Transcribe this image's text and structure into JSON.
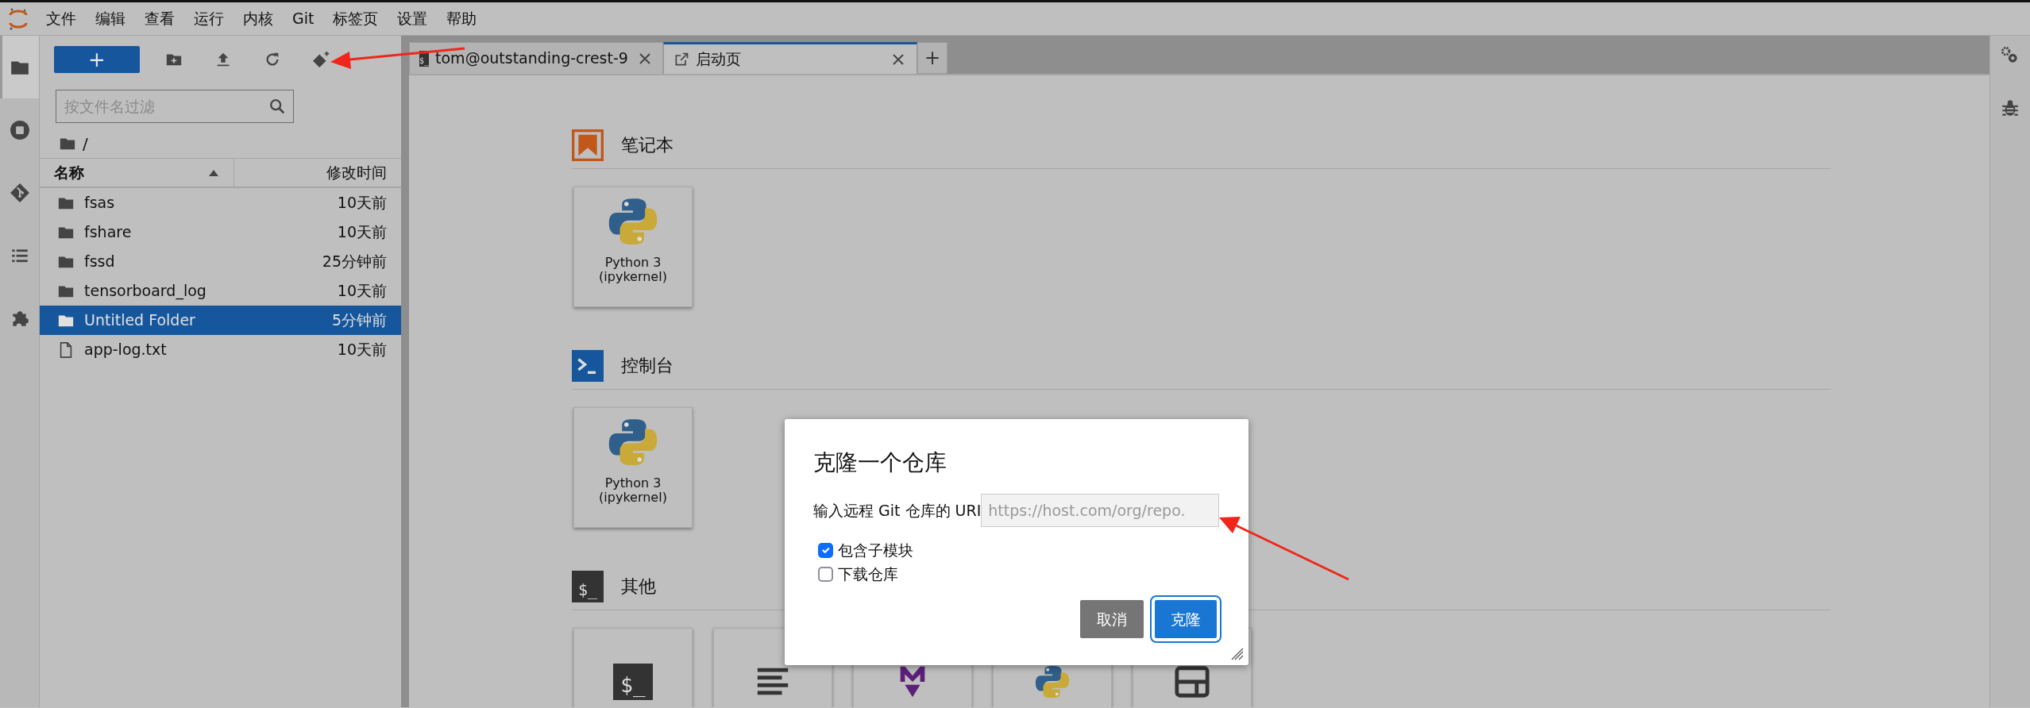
{
  "menu": [
    "文件",
    "编辑",
    "查看",
    "运行",
    "内核",
    "Git",
    "标签页",
    "设置",
    "帮助"
  ],
  "left_sidebar": [
    {
      "kind": "folder",
      "selected": true
    },
    {
      "kind": "stop",
      "selected": false
    },
    {
      "kind": "git",
      "selected": false
    },
    {
      "kind": "list",
      "selected": false
    },
    {
      "kind": "puzzle",
      "selected": false
    }
  ],
  "file_browser": {
    "new_button": "+",
    "filter": {
      "placeholder": "按文件名过滤"
    },
    "path": "/",
    "columns": [
      "名称",
      "修改时间"
    ],
    "rows": [
      {
        "kind": "folder",
        "name": "fsas",
        "modified": "10天前",
        "selected": false
      },
      {
        "kind": "folder",
        "name": "fshare",
        "modified": "10天前",
        "selected": false
      },
      {
        "kind": "folder",
        "name": "fssd",
        "modified": "25分钟前",
        "selected": false
      },
      {
        "kind": "folder",
        "name": "tensorboard_log",
        "modified": "10天前",
        "selected": false
      },
      {
        "kind": "folder",
        "name": "Untitled Folder",
        "modified": "5分钟前",
        "selected": true
      },
      {
        "kind": "file",
        "name": "app-log.txt",
        "modified": "10天前",
        "selected": false
      }
    ]
  },
  "tabs": [
    {
      "kind": "terminal",
      "icon_text": "$_",
      "label": "tom@outstanding-crest-9",
      "selected": false
    },
    {
      "kind": "launcher",
      "label": "启动页",
      "selected": true
    }
  ],
  "add_tab": "+",
  "launcher": [
    {
      "kind": "notebook",
      "title": "笔记本",
      "cards": [
        {
          "kind": "python",
          "label": "Python 3\n(ipykernel)"
        }
      ]
    },
    {
      "kind": "console",
      "title": "控制台",
      "cards": [
        {
          "kind": "python",
          "label": "Python 3\n(ipykernel)"
        }
      ]
    },
    {
      "kind": "other",
      "icon_text": "$_",
      "title": "其他",
      "cards": [
        {
          "kind": "terminal",
          "icon_text": "$_"
        },
        {
          "kind": "text"
        },
        {
          "kind": "markdown"
        },
        {
          "kind": "python"
        },
        {
          "kind": "layout"
        }
      ]
    }
  ],
  "right_sidebar": [
    {
      "kind": "gears"
    },
    {
      "kind": "bug"
    }
  ],
  "dialog": {
    "title": "克隆一个仓库",
    "uri_label": "输入远程 Git 仓库的 URI",
    "uri_field": {
      "placeholder": "https://host.com/org/repo."
    },
    "options": [
      {
        "label": "包含子模块",
        "checked": true
      },
      {
        "label": "下载仓库",
        "checked": false
      }
    ],
    "buttons": [
      {
        "kind": "cancel",
        "label": "取消"
      },
      {
        "kind": "accept",
        "label": "克隆"
      }
    ]
  }
}
